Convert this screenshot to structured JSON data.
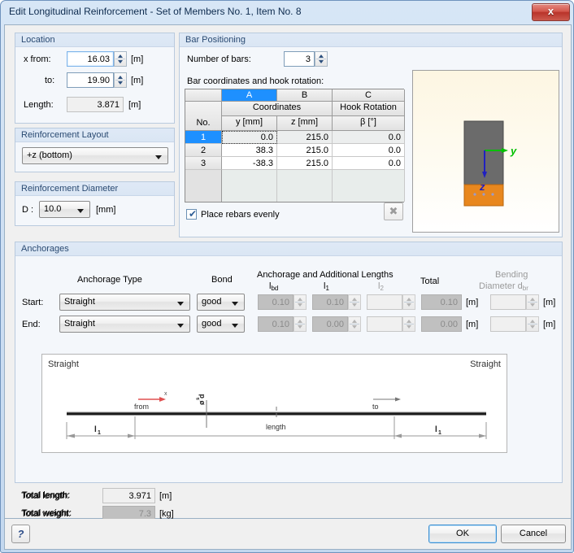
{
  "window": {
    "title": "Edit Longitudinal Reinforcement - Set of Members No. 1, Item No. 8",
    "close_label": "x"
  },
  "location": {
    "title": "Location",
    "x_from_label": "x from:",
    "x_from_value": "16.03",
    "x_from_unit": "[m]",
    "to_label": "to:",
    "to_value": "19.90",
    "to_unit": "[m]",
    "length_label": "Length:",
    "length_value": "3.871",
    "length_unit": "[m]"
  },
  "layout": {
    "title": "Reinforcement Layout",
    "value": "+z (bottom)",
    "options": [
      "+z (bottom)"
    ]
  },
  "diameter": {
    "title": "Reinforcement Diameter",
    "label": "D :",
    "value": "10.0",
    "unit": "[mm]",
    "options": [
      "10.0"
    ]
  },
  "bar_positioning": {
    "title": "Bar Positioning",
    "number_of_bars_label": "Number of bars:",
    "number_of_bars_value": "3",
    "table_caption": "Bar coordinates and hook rotation:",
    "columns": {
      "no": "No.",
      "letters": [
        "A",
        "B",
        "C"
      ],
      "group_coordinates": "Coordinates",
      "group_hook": "Hook Rotation",
      "sub": [
        "y [mm]",
        "z [mm]",
        "β [°]"
      ]
    },
    "rows": [
      {
        "no": "1",
        "y": "0.0",
        "z": "215.0",
        "beta": "0.0"
      },
      {
        "no": "2",
        "y": "38.3",
        "z": "215.0",
        "beta": "0.0"
      },
      {
        "no": "3",
        "y": "-38.3",
        "z": "215.0",
        "beta": "0.0"
      }
    ],
    "place_evenly_label": "Place rebars evenly",
    "place_evenly_checked": true,
    "delete_button_label": "✖"
  },
  "preview": {
    "axis_y_label": "y",
    "axis_z_label": "z",
    "section_color": "#6b6b6b",
    "rebar_color": "#e8871e",
    "axis_y_color": "#00c000",
    "axis_z_color": "#2020c0"
  },
  "anchorages": {
    "title": "Anchorages",
    "col_anchorage_type": "Anchorage Type",
    "col_bond": "Bond",
    "col_group_lengths": "Anchorage and Additional Lengths",
    "col_lbd": "lbd",
    "col_l1": "l1",
    "col_l2": "l2",
    "col_total": "Total",
    "col_bending_1": "Bending",
    "col_bending_2": "Diameter dbr",
    "rows": [
      {
        "label": "Start:",
        "type": "Straight",
        "bond": "good",
        "lbd": "0.10",
        "l1": "0.10",
        "l2": "",
        "total": "0.10",
        "total_unit": "[m]",
        "dbr": "",
        "dbr_unit": "[m]"
      },
      {
        "label": "End:",
        "type": "Straight",
        "bond": "good",
        "lbd": "0.10",
        "l1": "0.00",
        "l2": "",
        "total": "0.00",
        "total_unit": "[m]",
        "dbr": "",
        "dbr_unit": "[m]"
      }
    ]
  },
  "diagram": {
    "label_start": "Straight",
    "label_end": "Straight",
    "label_from": "from",
    "label_to": "to",
    "label_x": "x",
    "label_diameter": "ø d",
    "label_diameter_sub": "s",
    "label_length": "length",
    "label_l1_left": "l",
    "label_l1_left_sub": "1",
    "label_l1_right": "l",
    "label_l1_right_sub": "1"
  },
  "totals": {
    "total_length_label": "Total length:",
    "total_length_value": "3.971",
    "total_length_unit": "[m]",
    "total_weight_label": "Total weight:",
    "total_weight_value": "7.3",
    "total_weight_unit": "[kg]"
  },
  "footer": {
    "help_label": "?",
    "ok_label": "OK",
    "cancel_label": "Cancel"
  }
}
